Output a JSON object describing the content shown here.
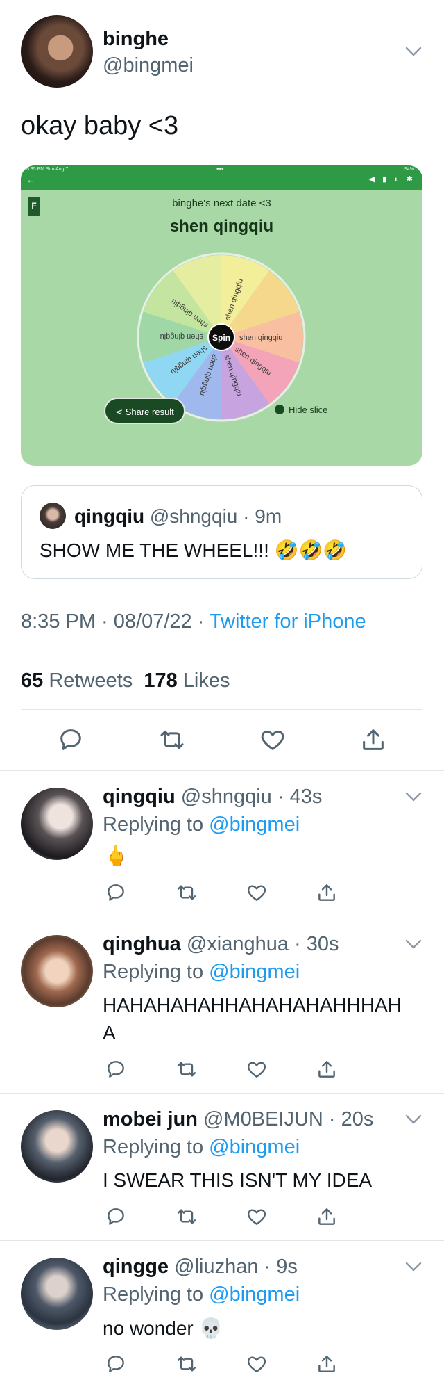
{
  "main_tweet": {
    "name": "binghe",
    "handle": "@bingmei",
    "text": "okay baby <3",
    "time": "8:35 PM",
    "date": "08/07/22",
    "source": "Twitter for iPhone",
    "retweets": "65",
    "retweets_label": "Retweets",
    "likes": "178",
    "likes_label": "Likes"
  },
  "screenshot": {
    "status_left": "6:35 PM  Sun Aug 7",
    "status_right": "94%",
    "subtitle": "binghe's next date <3",
    "title": "shen qingqiu",
    "slice_label": "shen qingqiu",
    "spin_label": "Spin",
    "share_label": "Share result",
    "hide_label": "Hide slice",
    "slice_colors": [
      "#f3ee9a",
      "#f6d88d",
      "#f8c0a0",
      "#f3a4b9",
      "#c7a3e0",
      "#9fb9ef",
      "#8fd7f2",
      "#9fd8a6",
      "#c4e5a0",
      "#e5eea0"
    ]
  },
  "quote": {
    "name": "qingqiu",
    "handle": "@shngqiu",
    "time": "9m",
    "text": "SHOW ME THE WHEEL!!! 🤣🤣🤣"
  },
  "replies": [
    {
      "name": "qingqiu",
      "handle": "@shngqiu",
      "time": "43s",
      "replying": "Replying to",
      "to": "@bingmei",
      "text": "🖕"
    },
    {
      "name": "qinghua",
      "handle": "@xianghua",
      "time": "30s",
      "replying": "Replying to",
      "to": "@bingmei",
      "text": "HAHAHAHAHHAHAHAHAHHHAH",
      "text2": "A"
    },
    {
      "name": "mobei jun",
      "handle": "@M0BEIJUN",
      "time": "20s",
      "replying": "Replying to",
      "to": "@bingmei",
      "text": "I SWEAR THIS ISN'T MY IDEA"
    },
    {
      "name": "qingge",
      "handle": "@liuzhan",
      "time": "9s",
      "replying": "Replying to",
      "to": "@bingmei",
      "text": "no wonder 💀"
    }
  ],
  "icons": [
    "chevron-down-icon",
    "reply-icon",
    "retweet-icon",
    "like-icon",
    "share-icon"
  ]
}
